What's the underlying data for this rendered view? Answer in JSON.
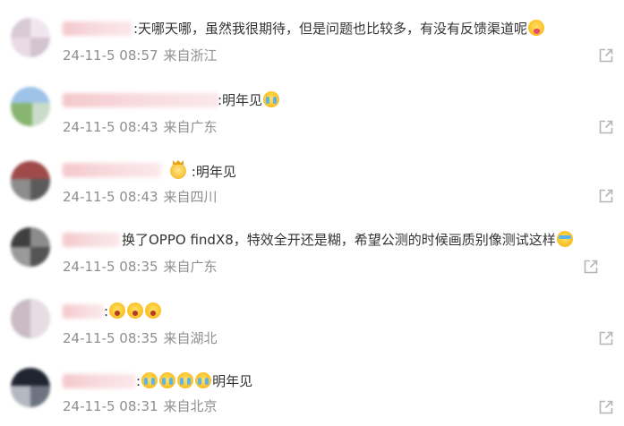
{
  "comments": [
    {
      "text_pre": ":天哪天哪，虽然我很期待，但是问题也比较多，有没有反馈渠道呢",
      "emojis": [
        "heart-eyes-emoji"
      ],
      "text_post": "",
      "time": "24-11-5 08:57",
      "location": "来自浙江"
    },
    {
      "text_pre": ":明年见",
      "emojis": [
        "crying-emoji"
      ],
      "text_post": "",
      "time": "24-11-5 08:43",
      "location": "来自广东"
    },
    {
      "text_pre": ":明年见",
      "emojis": [
        "crown-emoji"
      ],
      "text_post": "",
      "time": "24-11-5 08:43",
      "location": "来自四川"
    },
    {
      "text_pre": "换了OPPO findX8，特效全开还是糊，希望公测的时候画质别像测试这样",
      "emojis": [
        "tears-of-joy-emoji"
      ],
      "text_post": "",
      "time": "24-11-5 08:35",
      "location": "来自广东"
    },
    {
      "text_pre": ":",
      "emojis": [
        "shocked-emoji",
        "shocked-emoji",
        "shocked-emoji"
      ],
      "text_post": "",
      "time": "24-11-5 08:35",
      "location": "来自湖北"
    },
    {
      "text_pre": ":",
      "emojis": [
        "crying-emoji",
        "crying-emoji",
        "crying-emoji",
        "crying-emoji"
      ],
      "text_post": "明年见",
      "time": "24-11-5 08:31",
      "location": "来自北京"
    }
  ],
  "icons": {
    "share": "share-icon"
  },
  "colors": {
    "text": "#333333",
    "meta": "#8f8f8f",
    "icon": "#b5b5b5"
  }
}
